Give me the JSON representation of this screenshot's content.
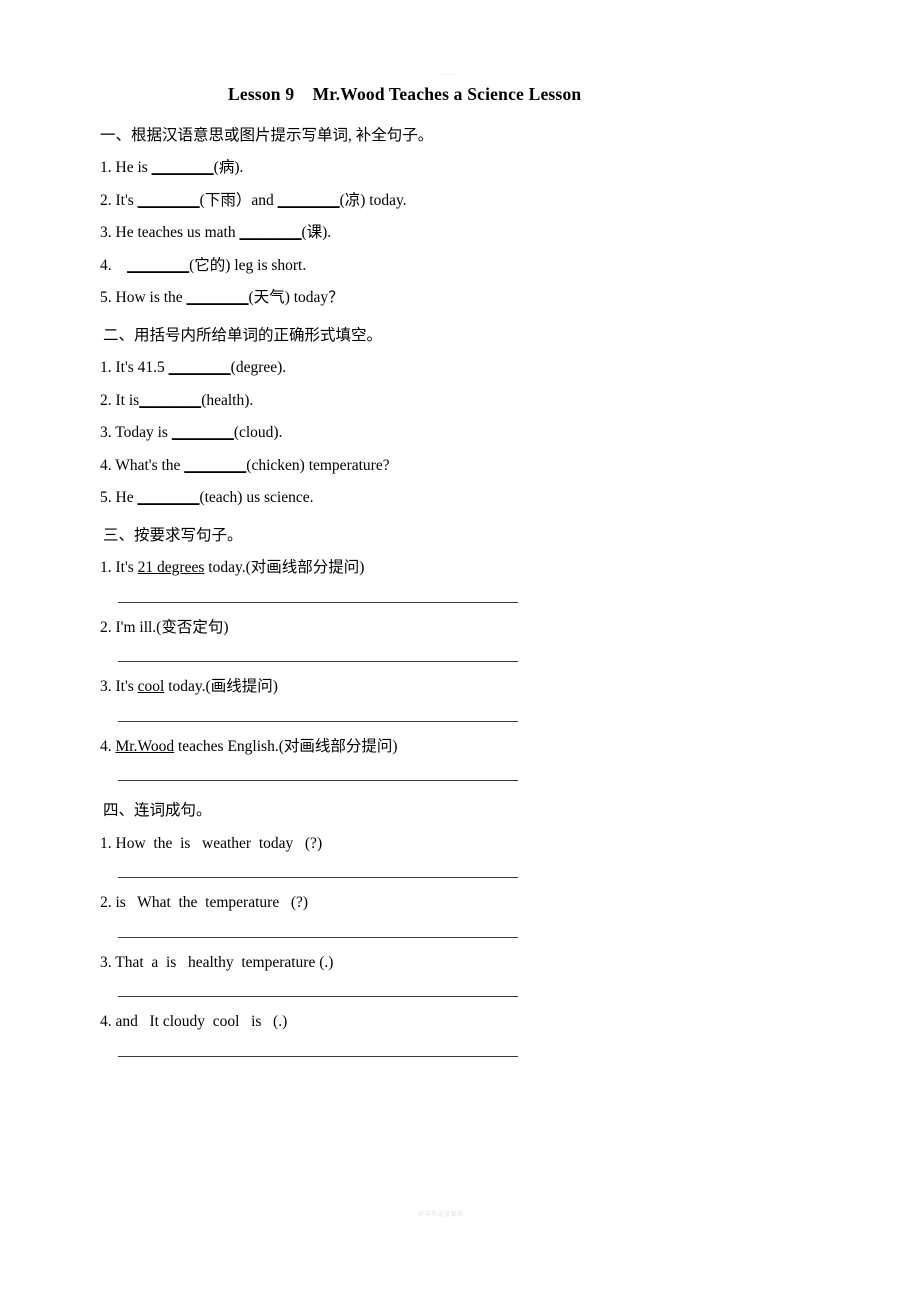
{
  "document": {
    "title": "Lesson 9    Mr.Wood Teaches a Science Lesson",
    "title_dots": "....",
    "watermark": "初中英语资源网"
  },
  "sections": [
    {
      "heading": "一、根据汉语意思或图片提示写单词, 补全句子。",
      "items": [
        {
          "num": "1.",
          "before": " He is ",
          "blank": "________",
          "after": "(病)."
        },
        {
          "num": "2.",
          "before": " It's ",
          "blank": "________",
          "after": "(下雨）and ",
          "blank2": "________",
          "after2": "(凉) today."
        },
        {
          "num": "3.",
          "before": " He teaches us math ",
          "blank": "________",
          "after": "(课)."
        },
        {
          "num": "4.",
          "before": "    ",
          "blank": "________",
          "after": "(它的) leg is short."
        },
        {
          "num": "5.",
          "before": " How is the ",
          "blank": "________",
          "after": "(天气) today？"
        }
      ]
    },
    {
      "heading": "二、用括号内所给单词的正确形式填空。",
      "items": [
        {
          "num": "1.",
          "before": " It's 41.5 ",
          "blank": "________",
          "after": "(degree)."
        },
        {
          "num": "2.",
          "before": " It is",
          "blank": "________",
          "after": "(health)."
        },
        {
          "num": "3.",
          "before": " Today is ",
          "blank": "________",
          "after": "(cloud)."
        },
        {
          "num": "4.",
          "before": " What's the ",
          "blank": "________",
          "after": "(chicken) temperature?"
        },
        {
          "num": "5.",
          "before": " He ",
          "blank": "________",
          "after": "(teach) us science."
        }
      ]
    },
    {
      "heading": "三、按要求写句子。",
      "items": [
        {
          "num": "1.",
          "before": " It's ",
          "underline": "21 degrees",
          "after": " today.(对画线部分提问)"
        },
        {
          "num": "2.",
          "before": " I'm ill.(变否定句)",
          "underline": "",
          "after": ""
        },
        {
          "num": "3.",
          "before": " It's ",
          "underline": "cool",
          "after": " today.(画线提问)"
        },
        {
          "num": "4.",
          "before": " ",
          "underline": "Mr.Wood",
          "after": " teaches English.(对画线部分提问)"
        }
      ]
    },
    {
      "heading": "四、连词成句。",
      "items": [
        {
          "num": "1.",
          "text": " How  the  is   weather  today   (?)"
        },
        {
          "num": "2.",
          "text": " is   What  the  temperature   (?)"
        },
        {
          "num": "3.",
          "text": " That  a  is   healthy  temperature (.)"
        },
        {
          "num": "4.",
          "text": " and   It cloudy  cool   is   (.)"
        }
      ]
    }
  ]
}
